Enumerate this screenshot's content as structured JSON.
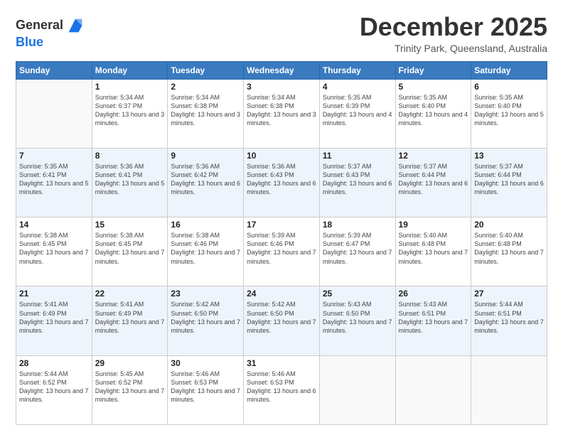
{
  "header": {
    "logo_line1": "General",
    "logo_line2": "Blue",
    "month_title": "December 2025",
    "subtitle": "Trinity Park, Queensland, Australia"
  },
  "weekdays": [
    "Sunday",
    "Monday",
    "Tuesday",
    "Wednesday",
    "Thursday",
    "Friday",
    "Saturday"
  ],
  "weeks": [
    [
      {
        "day": "",
        "sunrise": "",
        "sunset": "",
        "daylight": ""
      },
      {
        "day": "1",
        "sunrise": "Sunrise: 5:34 AM",
        "sunset": "Sunset: 6:37 PM",
        "daylight": "Daylight: 13 hours and 3 minutes."
      },
      {
        "day": "2",
        "sunrise": "Sunrise: 5:34 AM",
        "sunset": "Sunset: 6:38 PM",
        "daylight": "Daylight: 13 hours and 3 minutes."
      },
      {
        "day": "3",
        "sunrise": "Sunrise: 5:34 AM",
        "sunset": "Sunset: 6:38 PM",
        "daylight": "Daylight: 13 hours and 3 minutes."
      },
      {
        "day": "4",
        "sunrise": "Sunrise: 5:35 AM",
        "sunset": "Sunset: 6:39 PM",
        "daylight": "Daylight: 13 hours and 4 minutes."
      },
      {
        "day": "5",
        "sunrise": "Sunrise: 5:35 AM",
        "sunset": "Sunset: 6:40 PM",
        "daylight": "Daylight: 13 hours and 4 minutes."
      },
      {
        "day": "6",
        "sunrise": "Sunrise: 5:35 AM",
        "sunset": "Sunset: 6:40 PM",
        "daylight": "Daylight: 13 hours and 5 minutes."
      }
    ],
    [
      {
        "day": "7",
        "sunrise": "Sunrise: 5:35 AM",
        "sunset": "Sunset: 6:41 PM",
        "daylight": "Daylight: 13 hours and 5 minutes."
      },
      {
        "day": "8",
        "sunrise": "Sunrise: 5:36 AM",
        "sunset": "Sunset: 6:41 PM",
        "daylight": "Daylight: 13 hours and 5 minutes."
      },
      {
        "day": "9",
        "sunrise": "Sunrise: 5:36 AM",
        "sunset": "Sunset: 6:42 PM",
        "daylight": "Daylight: 13 hours and 6 minutes."
      },
      {
        "day": "10",
        "sunrise": "Sunrise: 5:36 AM",
        "sunset": "Sunset: 6:43 PM",
        "daylight": "Daylight: 13 hours and 6 minutes."
      },
      {
        "day": "11",
        "sunrise": "Sunrise: 5:37 AM",
        "sunset": "Sunset: 6:43 PM",
        "daylight": "Daylight: 13 hours and 6 minutes."
      },
      {
        "day": "12",
        "sunrise": "Sunrise: 5:37 AM",
        "sunset": "Sunset: 6:44 PM",
        "daylight": "Daylight: 13 hours and 6 minutes."
      },
      {
        "day": "13",
        "sunrise": "Sunrise: 5:37 AM",
        "sunset": "Sunset: 6:44 PM",
        "daylight": "Daylight: 13 hours and 6 minutes."
      }
    ],
    [
      {
        "day": "14",
        "sunrise": "Sunrise: 5:38 AM",
        "sunset": "Sunset: 6:45 PM",
        "daylight": "Daylight: 13 hours and 7 minutes."
      },
      {
        "day": "15",
        "sunrise": "Sunrise: 5:38 AM",
        "sunset": "Sunset: 6:45 PM",
        "daylight": "Daylight: 13 hours and 7 minutes."
      },
      {
        "day": "16",
        "sunrise": "Sunrise: 5:38 AM",
        "sunset": "Sunset: 6:46 PM",
        "daylight": "Daylight: 13 hours and 7 minutes."
      },
      {
        "day": "17",
        "sunrise": "Sunrise: 5:39 AM",
        "sunset": "Sunset: 6:46 PM",
        "daylight": "Daylight: 13 hours and 7 minutes."
      },
      {
        "day": "18",
        "sunrise": "Sunrise: 5:39 AM",
        "sunset": "Sunset: 6:47 PM",
        "daylight": "Daylight: 13 hours and 7 minutes."
      },
      {
        "day": "19",
        "sunrise": "Sunrise: 5:40 AM",
        "sunset": "Sunset: 6:48 PM",
        "daylight": "Daylight: 13 hours and 7 minutes."
      },
      {
        "day": "20",
        "sunrise": "Sunrise: 5:40 AM",
        "sunset": "Sunset: 6:48 PM",
        "daylight": "Daylight: 13 hours and 7 minutes."
      }
    ],
    [
      {
        "day": "21",
        "sunrise": "Sunrise: 5:41 AM",
        "sunset": "Sunset: 6:49 PM",
        "daylight": "Daylight: 13 hours and 7 minutes."
      },
      {
        "day": "22",
        "sunrise": "Sunrise: 5:41 AM",
        "sunset": "Sunset: 6:49 PM",
        "daylight": "Daylight: 13 hours and 7 minutes."
      },
      {
        "day": "23",
        "sunrise": "Sunrise: 5:42 AM",
        "sunset": "Sunset: 6:50 PM",
        "daylight": "Daylight: 13 hours and 7 minutes."
      },
      {
        "day": "24",
        "sunrise": "Sunrise: 5:42 AM",
        "sunset": "Sunset: 6:50 PM",
        "daylight": "Daylight: 13 hours and 7 minutes."
      },
      {
        "day": "25",
        "sunrise": "Sunrise: 5:43 AM",
        "sunset": "Sunset: 6:50 PM",
        "daylight": "Daylight: 13 hours and 7 minutes."
      },
      {
        "day": "26",
        "sunrise": "Sunrise: 5:43 AM",
        "sunset": "Sunset: 6:51 PM",
        "daylight": "Daylight: 13 hours and 7 minutes."
      },
      {
        "day": "27",
        "sunrise": "Sunrise: 5:44 AM",
        "sunset": "Sunset: 6:51 PM",
        "daylight": "Daylight: 13 hours and 7 minutes."
      }
    ],
    [
      {
        "day": "28",
        "sunrise": "Sunrise: 5:44 AM",
        "sunset": "Sunset: 6:52 PM",
        "daylight": "Daylight: 13 hours and 7 minutes."
      },
      {
        "day": "29",
        "sunrise": "Sunrise: 5:45 AM",
        "sunset": "Sunset: 6:52 PM",
        "daylight": "Daylight: 13 hours and 7 minutes."
      },
      {
        "day": "30",
        "sunrise": "Sunrise: 5:46 AM",
        "sunset": "Sunset: 6:53 PM",
        "daylight": "Daylight: 13 hours and 7 minutes."
      },
      {
        "day": "31",
        "sunrise": "Sunrise: 5:46 AM",
        "sunset": "Sunset: 6:53 PM",
        "daylight": "Daylight: 13 hours and 6 minutes."
      },
      {
        "day": "",
        "sunrise": "",
        "sunset": "",
        "daylight": ""
      },
      {
        "day": "",
        "sunrise": "",
        "sunset": "",
        "daylight": ""
      },
      {
        "day": "",
        "sunrise": "",
        "sunset": "",
        "daylight": ""
      }
    ]
  ]
}
